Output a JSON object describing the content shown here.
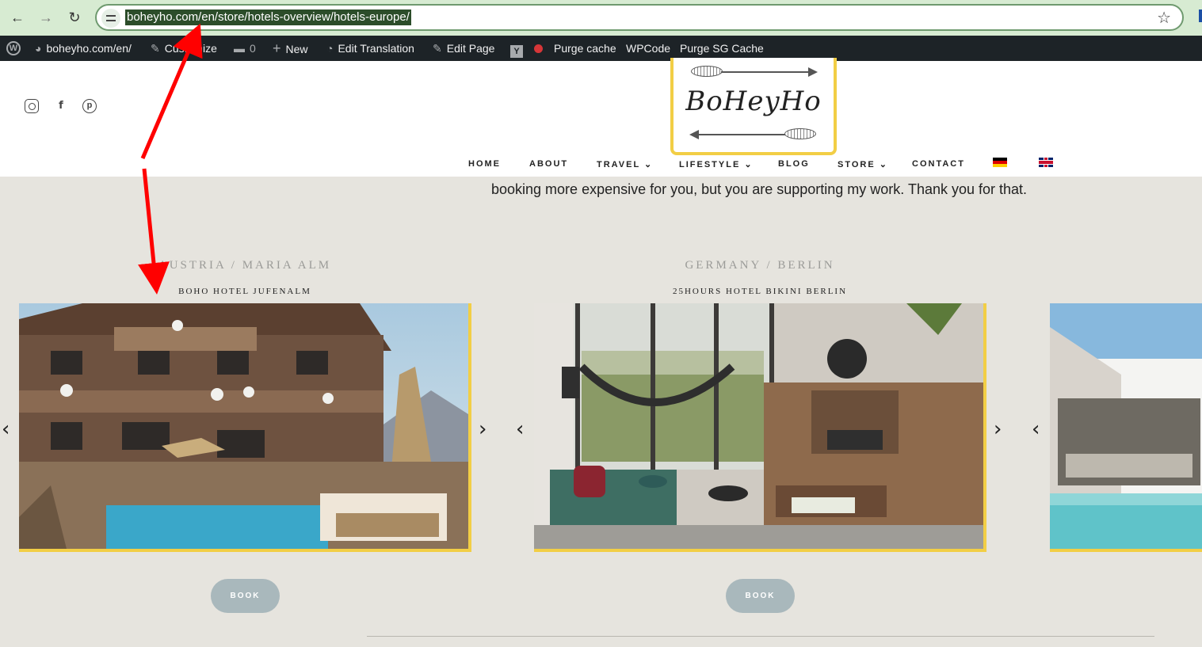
{
  "browser": {
    "url": "boheyho.com/en/store/hotels-overview/hotels-europe/",
    "back_icon": "arrow-left-icon",
    "forward_icon": "arrow-right-icon",
    "reload_icon": "reload-icon",
    "bookmark_icon": "star-icon",
    "back_glyph": "←",
    "forward_glyph": "→",
    "reload_glyph": "↻",
    "star_glyph": "☆"
  },
  "admin_bar": {
    "site": "boheyho.com/en/",
    "customize": "Customize",
    "comments_count": "0",
    "new": "New",
    "edit_translation": "Edit Translation",
    "edit_page": "Edit Page",
    "purge_cache": "Purge cache",
    "wpcode": "WPCode",
    "purge_sg": "Purge SG Cache"
  },
  "header": {
    "logo_text": "BoHeyHo",
    "nav": [
      {
        "label": "HOME"
      },
      {
        "label": "ABOUT"
      },
      {
        "label": "TRAVEL ⌄"
      },
      {
        "label": "LIFESTYLE ⌄"
      },
      {
        "label": "BLOG"
      },
      {
        "label": "STORE ⌄"
      },
      {
        "label": "CONTACT"
      }
    ],
    "social_icons": [
      "instagram-icon",
      "facebook-icon",
      "pinterest-icon"
    ],
    "languages": [
      "german-flag-icon",
      "english-flag-icon"
    ]
  },
  "content": {
    "intro_text": "booking more expensive for you, but you are supporting my work. Thank you for that.",
    "hotels": [
      {
        "region": "AUSTRIA / MARIA ALM",
        "name": "BOHO HOTEL JUFENALM",
        "book_label": "BOOK"
      },
      {
        "region": "GERMANY / BERLIN",
        "name": "25HOURS HOTEL BIKINI BERLIN",
        "book_label": "BOOK"
      }
    ],
    "arrow_prev": "‹",
    "arrow_next": "›"
  },
  "colors": {
    "accent_yellow": "#f2ce45",
    "page_bg": "#e6e4de",
    "admin_bar": "#1d2327",
    "book_button": "#a9b8bc",
    "annotation_red": "#ff0000"
  }
}
